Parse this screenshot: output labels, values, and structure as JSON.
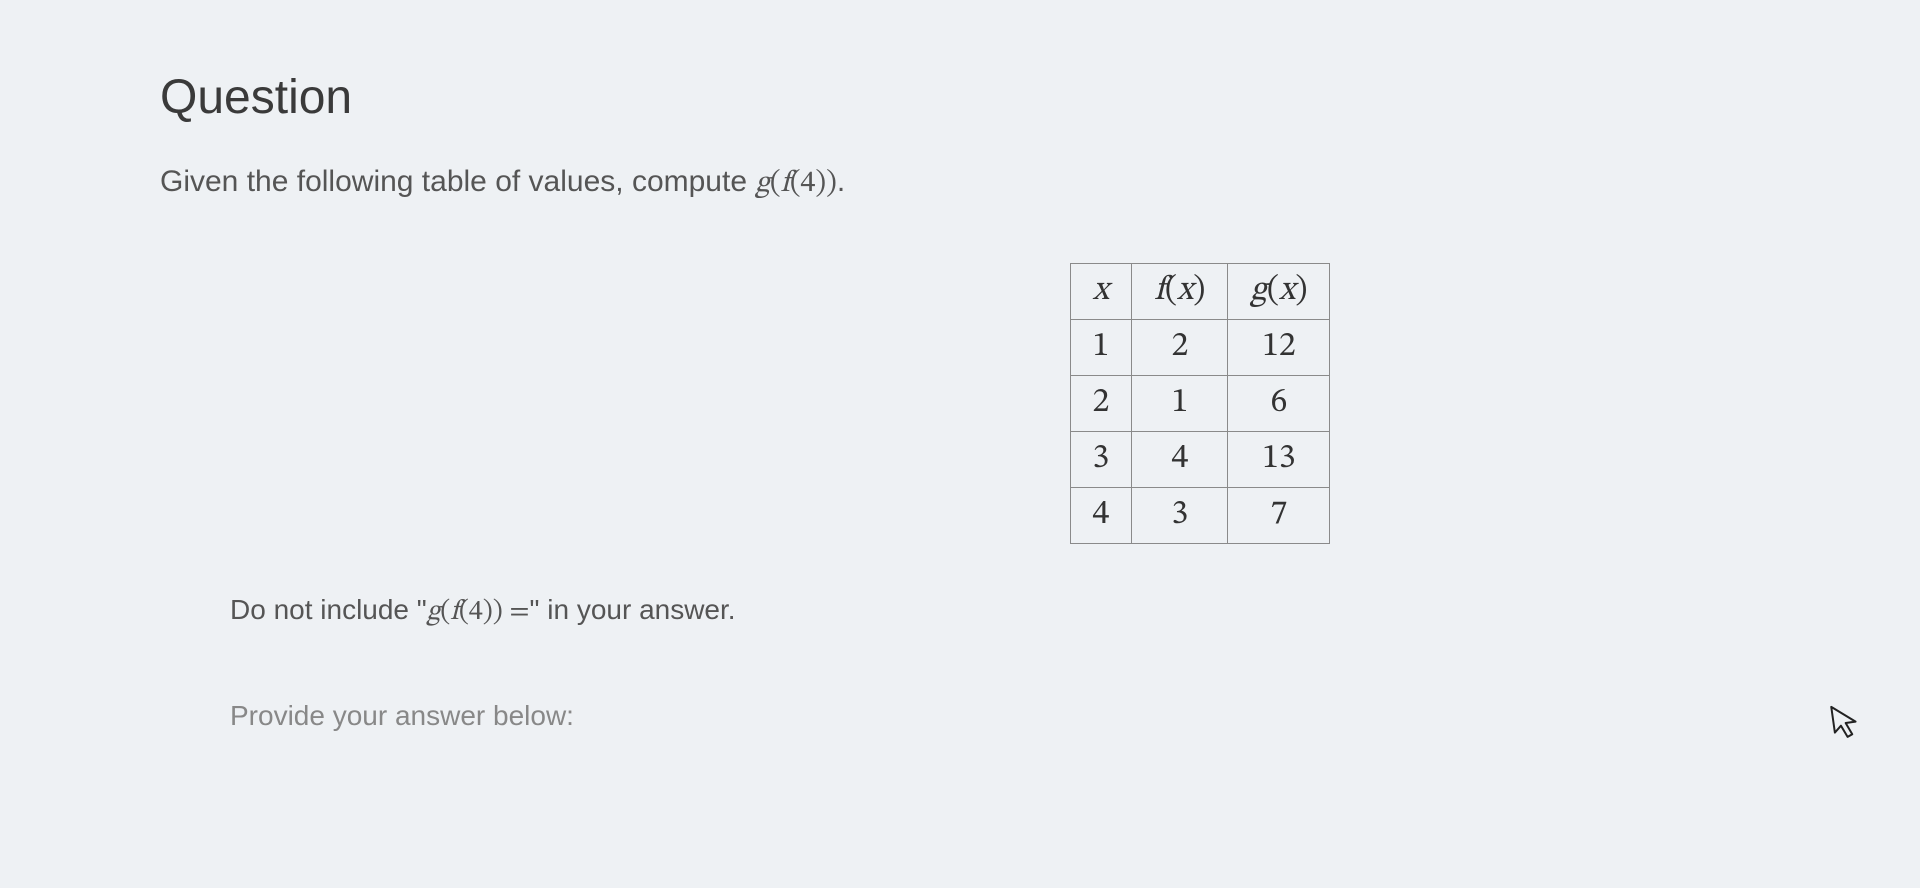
{
  "heading": "Question",
  "prompt_prefix": "Given the following table of values, compute ",
  "prompt_expr_g": "g",
  "prompt_expr_f": "f",
  "prompt_expr_arg": "4",
  "prompt_expr_suffix": ".",
  "table": {
    "headers": {
      "x": "x",
      "fx_f": "f",
      "fx_x": "x",
      "gx_g": "g",
      "gx_x": "x"
    },
    "rows": [
      {
        "x": "1",
        "fx": "2",
        "gx": "12"
      },
      {
        "x": "2",
        "fx": "1",
        "gx": "6"
      },
      {
        "x": "3",
        "fx": "4",
        "gx": "13"
      },
      {
        "x": "4",
        "fx": "3",
        "gx": "7"
      }
    ]
  },
  "hint_prefix": "Do not include \"",
  "hint_expr_g": "g",
  "hint_expr_f": "f",
  "hint_expr_arg": "4",
  "hint_eq": " =",
  "hint_suffix": "\" in your answer.",
  "provide": "Provide your answer below:"
}
